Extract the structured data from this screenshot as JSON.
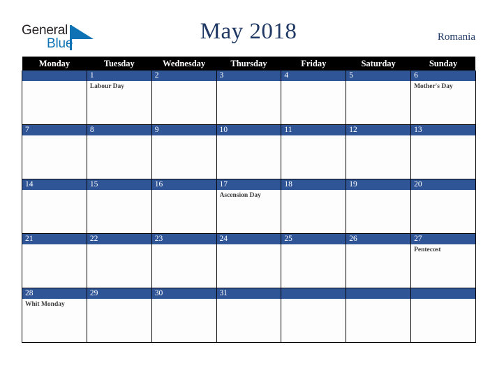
{
  "brand": {
    "logo_text_top": "General",
    "logo_text_bottom": "Blue",
    "logo_top_color": "#231f20",
    "logo_bottom_color": "#0e72b5",
    "logo_triangle_color": "#0e72b5"
  },
  "header": {
    "title": "May 2018",
    "country": "Romania",
    "title_color": "#1f3864",
    "country_color": "#1f3864"
  },
  "calendar": {
    "accent_color": "#2f5597",
    "header_bg_color": "#000000",
    "header_text_color": "#ffffff",
    "weekdays": [
      "Monday",
      "Tuesday",
      "Wednesday",
      "Thursday",
      "Friday",
      "Saturday",
      "Sunday"
    ],
    "weeks": [
      [
        {
          "day": "",
          "events": []
        },
        {
          "day": "1",
          "events": [
            "Labour Day"
          ]
        },
        {
          "day": "2",
          "events": []
        },
        {
          "day": "3",
          "events": []
        },
        {
          "day": "4",
          "events": []
        },
        {
          "day": "5",
          "events": []
        },
        {
          "day": "6",
          "events": [
            "Mother's Day"
          ]
        }
      ],
      [
        {
          "day": "7",
          "events": []
        },
        {
          "day": "8",
          "events": []
        },
        {
          "day": "9",
          "events": []
        },
        {
          "day": "10",
          "events": []
        },
        {
          "day": "11",
          "events": []
        },
        {
          "day": "12",
          "events": []
        },
        {
          "day": "13",
          "events": []
        }
      ],
      [
        {
          "day": "14",
          "events": []
        },
        {
          "day": "15",
          "events": []
        },
        {
          "day": "16",
          "events": []
        },
        {
          "day": "17",
          "events": [
            "Ascension Day"
          ]
        },
        {
          "day": "18",
          "events": []
        },
        {
          "day": "19",
          "events": []
        },
        {
          "day": "20",
          "events": []
        }
      ],
      [
        {
          "day": "21",
          "events": []
        },
        {
          "day": "22",
          "events": []
        },
        {
          "day": "23",
          "events": []
        },
        {
          "day": "24",
          "events": []
        },
        {
          "day": "25",
          "events": []
        },
        {
          "day": "26",
          "events": []
        },
        {
          "day": "27",
          "events": [
            "Pentecost"
          ]
        }
      ],
      [
        {
          "day": "28",
          "events": [
            "Whit Monday"
          ]
        },
        {
          "day": "29",
          "events": []
        },
        {
          "day": "30",
          "events": []
        },
        {
          "day": "31",
          "events": []
        },
        {
          "day": "",
          "events": []
        },
        {
          "day": "",
          "events": []
        },
        {
          "day": "",
          "events": []
        }
      ]
    ]
  }
}
